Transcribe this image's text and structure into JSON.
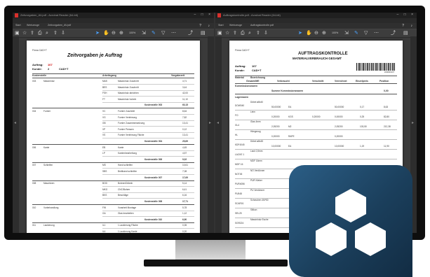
{
  "left_window": {
    "title": "Zeitvorgaben_AV.pdf - Acrobat Reader (64-bit)",
    "menu": [
      "Datei",
      "Bearbeiten",
      "Anzeige",
      "Elektronisch unterschreiben",
      "Fenster",
      "Hilfe"
    ],
    "tabs": [
      "Start",
      "Werkzeuge",
      "Zeitvorgaben_AV.pdf"
    ],
    "zoom": "100%",
    "document": {
      "company": "Firma CAD+T",
      "title": "Zeitvorgaben je Auftrag",
      "auftrag_label": "Auftrag:",
      "auftrag_value": "107",
      "kunde_label": "Kunde:",
      "kunde_value": "2",
      "kunde_name": "CAD+T",
      "headers": [
        "Kostenstelle",
        "Arbeitsgang",
        "Vorgabezeit"
      ],
      "rows": [
        [
          "003",
          "Massivholz",
          "MAS",
          "Massivholz Zuschnitt",
          "4,71"
        ],
        [
          "",
          "",
          "BES",
          "Massivholz Zuschnitt",
          "3,44"
        ],
        [
          "",
          "",
          "FSH",
          "Massivholz abrichten",
          "42,00"
        ],
        [
          "",
          "",
          "FT",
          "Massivholz hobeln",
          "11,10"
        ],
        [
          "",
          "",
          "",
          "Kostenstelle 003",
          "60,15"
        ],
        [
          "004",
          "Furnier",
          "VC",
          "Furnier Zuschnitt",
          "8,64"
        ],
        [
          "",
          "",
          "VG",
          "Furnier Verleimung",
          "7,82"
        ],
        [
          "",
          "",
          "GB",
          "Furnier Zusammensetzung",
          "13,41"
        ],
        [
          "",
          "",
          "VP",
          "Furnier Pressen",
          "0,12"
        ],
        [
          "",
          "",
          "VS",
          "Furnier Verleimung Fläche",
          "13,41"
        ],
        [
          "",
          "",
          "",
          "Kostenstelle 004",
          "29,89"
        ],
        [
          "006",
          "Kante",
          "EB",
          "Kante",
          "4,45"
        ],
        [
          "",
          "",
          "LP",
          "Kantenbearbeitung",
          "4,57"
        ],
        [
          "",
          "",
          "",
          "Kostenstelle 006",
          "9,02"
        ],
        [
          "007",
          "Schleifen",
          "MS",
          "Hand schleifen",
          "10,61"
        ],
        [
          "",
          "",
          "SBS",
          "Breitband schleifen",
          "7,08"
        ],
        [
          "",
          "",
          "",
          "Kostenstelle 007",
          "17,69"
        ],
        [
          "008",
          "Maschinen",
          "BOD",
          "Bohren/Dübeln",
          "5,14"
        ],
        [
          "",
          "",
          "MKG",
          "CNC/Bohrer",
          "6,41"
        ],
        [
          "",
          "",
          "BKS",
          "Beschläge",
          "6,16"
        ],
        [
          "",
          "",
          "",
          "Kostenstelle 008",
          "17,71"
        ],
        [
          "010",
          "Vorbehandlung",
          "FW",
          "Vorarbeit Montage",
          "5,78"
        ],
        [
          "",
          "",
          "GA",
          "Glas bearbeiten",
          "1,12"
        ],
        [
          "",
          "",
          "",
          "Kostenstelle 010",
          "6,90"
        ],
        [
          "011",
          "Lackierung",
          "IL1",
          "1.Lackierung Fläche",
          "0,35"
        ],
        [
          "",
          "",
          "IL4",
          "1.Lackierung Kante",
          "0,20"
        ],
        [
          "",
          "",
          "VL1",
          "1.Lackierung Kante / Beizen",
          "0,31"
        ]
      ]
    }
  },
  "right_window": {
    "title": "Auftragskontrolle.pdf - Acrobat Reader (64-bit)",
    "menu": [
      "Datei",
      "Bearbeiten",
      "Anzeige",
      "Elektronisch unterschreiben",
      "Fenster",
      "Hilfe"
    ],
    "tabs": [
      "Start",
      "Werkzeuge",
      "Auftragskontrolle.pdf"
    ],
    "zoom": "100%",
    "document": {
      "company": "Firma CAD+T",
      "title": "AUFTRAGSKONTROLLE",
      "subtitle": "MATERIALVERBRAUCH GESAMT",
      "auftrag_label": "Auftrag:",
      "auftrag_value": "107",
      "kunde_label": "Kunde:",
      "kunde_value": "CAD+T",
      "barcode_caption": "1030000107",
      "headers": [
        "Material",
        "Bezeichnung",
        "Gesamt/ME",
        "Verbraucht",
        "Verschnitt",
        "Verrechnet",
        "Einzelpreis",
        "Position"
      ],
      "section1": "Kommissionswaren",
      "section1_sum_label": "Summe Kommissionswaren",
      "section1_sum": "0,00",
      "section2": "Lagerwaren",
      "rows": [
        [
          "DOW040",
          "Dübel ø8x40",
          "",
          "50,00000",
          "EA",
          "",
          "50,00000",
          "0,17",
          "8,63"
        ],
        [
          "FO",
          "Leim",
          "",
          "0,20000",
          "KGS",
          "0,20000",
          "0,00000",
          "0,25",
          "82,80"
        ],
        [
          "GL4",
          "Glas 4mm",
          "",
          "2,05200",
          "M2",
          "",
          "2,05200",
          "103,50",
          "212,38"
        ],
        [
          "HL",
          "Hängezug",
          "",
          "0,20000",
          "RAPE",
          "",
          "0,20000",
          "",
          ""
        ],
        [
          "KDF4045",
          "Dübel ø8x45",
          "",
          "10,00000",
          "EA",
          "",
          "10,00000",
          "1,19",
          "11,90"
        ],
        [
          "LACKE 1",
          "Lack 0,5mm",
          "",
          "",
          "",
          "",
          "",
          "",
          ""
        ],
        [
          "MDF 16",
          "MDF 16mm",
          "",
          "",
          "",
          "",
          "",
          "",
          ""
        ],
        [
          "NOT45",
          "NO Verdünner",
          "",
          "",
          "",
          "",
          "",
          "",
          ""
        ],
        [
          "PUR4056",
          "PUR Kleber",
          "",
          "",
          "",
          "",
          "",
          "",
          ""
        ],
        [
          "PU548",
          "PU Verdünner",
          "",
          "",
          "",
          "",
          "",
          "",
          ""
        ],
        [
          "SCAR01",
          "Schrauben 4M*50",
          "",
          "",
          "",
          "",
          "",
          "",
          ""
        ],
        [
          "SEL25",
          "Silikon",
          "",
          "",
          "",
          "",
          "",
          "",
          ""
        ],
        [
          "SGR224",
          "Massivholz Esche",
          "",
          "",
          "",
          "",
          "",
          "",
          ""
        ]
      ]
    }
  },
  "app_icon": {
    "name": "hexagon-cluster-icon",
    "color": "#1f4868"
  }
}
